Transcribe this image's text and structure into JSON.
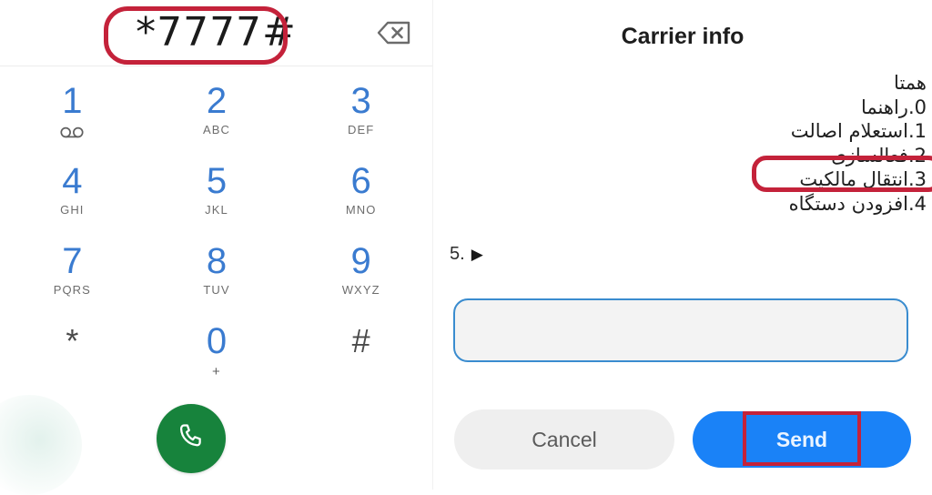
{
  "dialer": {
    "entered_number": "*7777#",
    "backspace_icon": "backspace-icon",
    "call_icon": "phone-handset-icon",
    "keys": [
      {
        "digit": "1",
        "sub": "",
        "icon": "voicemail-icon",
        "style": "digit"
      },
      {
        "digit": "2",
        "sub": "ABC",
        "icon": "",
        "style": "digit"
      },
      {
        "digit": "3",
        "sub": "DEF",
        "icon": "",
        "style": "digit"
      },
      {
        "digit": "4",
        "sub": "GHI",
        "icon": "",
        "style": "digit"
      },
      {
        "digit": "5",
        "sub": "JKL",
        "icon": "",
        "style": "digit"
      },
      {
        "digit": "6",
        "sub": "MNO",
        "icon": "",
        "style": "digit"
      },
      {
        "digit": "7",
        "sub": "PQRS",
        "icon": "",
        "style": "digit"
      },
      {
        "digit": "8",
        "sub": "TUV",
        "icon": "",
        "style": "digit"
      },
      {
        "digit": "9",
        "sub": "WXYZ",
        "icon": "",
        "style": "digit"
      },
      {
        "digit": "*",
        "sub": "",
        "icon": "",
        "style": "symbol"
      },
      {
        "digit": "0",
        "sub": "+",
        "icon": "",
        "style": "digit"
      },
      {
        "digit": "#",
        "sub": "",
        "icon": "",
        "style": "symbol"
      }
    ]
  },
  "ussd_dialog": {
    "title": "Carrier info",
    "message_lines": [
      "همتا",
      "0.راهنما",
      "1.استعلام اصالت",
      "2.فعالسازی",
      "3.انتقال مالکیت",
      "4.افزودن دستگاه"
    ],
    "more_label": "5.",
    "more_arrow": "▶",
    "input_value": "",
    "input_placeholder": "",
    "cancel_label": "Cancel",
    "send_label": "Send"
  },
  "annotations": [
    {
      "name": "annotation-dialed-number",
      "target": "*7777#",
      "color": "#c4223a",
      "shape": "rounded-rect"
    },
    {
      "name": "annotation-menu-option",
      "target": "2.فعالسازی",
      "color": "#c4223a",
      "shape": "rounded-rect"
    },
    {
      "name": "annotation-send-button",
      "target": "Send",
      "color": "#c4223a",
      "shape": "rect"
    }
  ],
  "colors": {
    "key_digit_blue": "#3a7bd0",
    "call_green": "#17833c",
    "send_blue": "#1a82f7",
    "cancel_gray": "#efefef",
    "annotation_red": "#c4223a",
    "input_border_blue": "#3a8ccf"
  }
}
